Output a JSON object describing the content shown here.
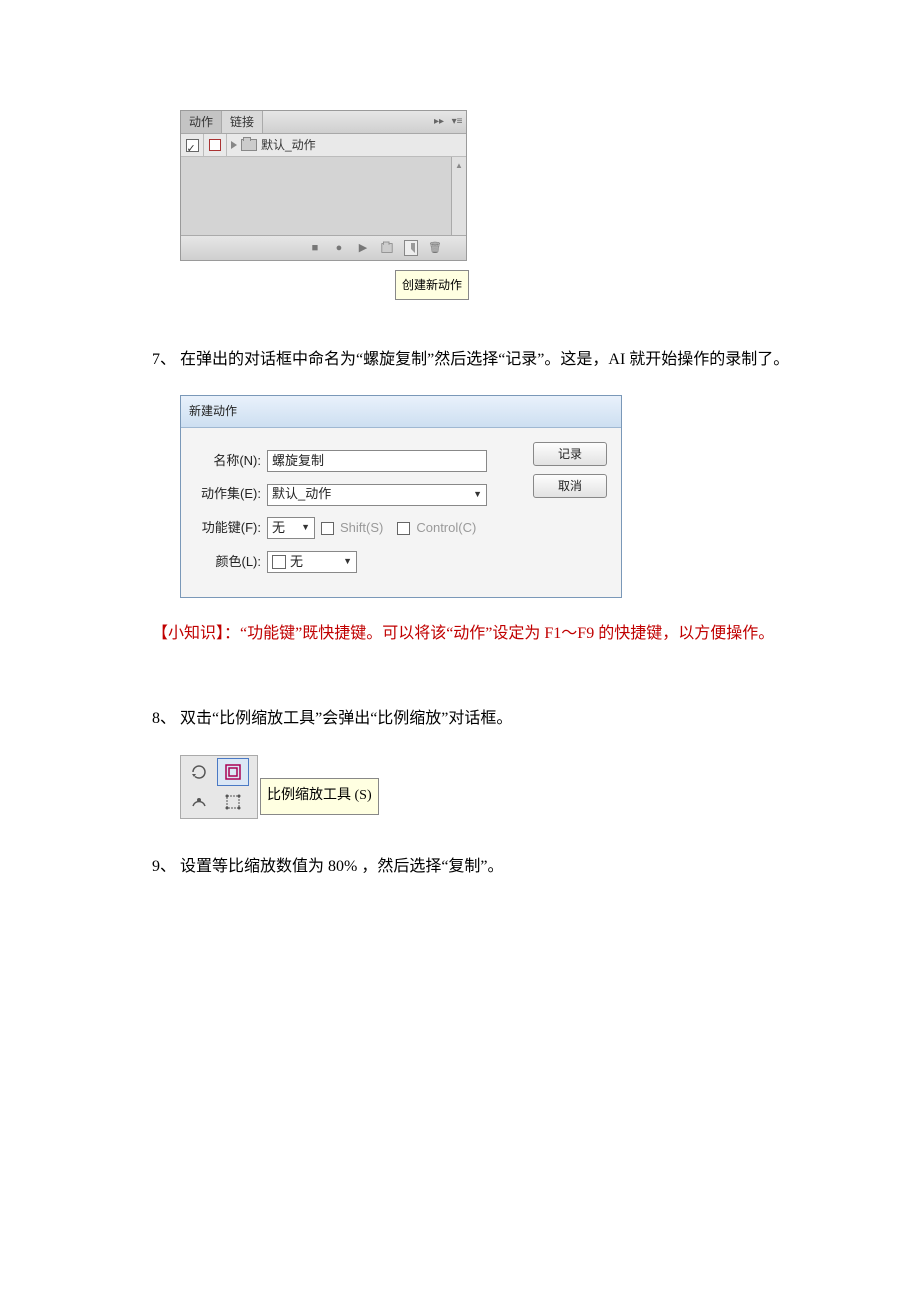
{
  "actions_panel": {
    "tab_actions": "动作",
    "tab_links": "链接",
    "row_label": "默认_动作",
    "tooltip": "创建新动作"
  },
  "step7": "7、 在弹出的对话框中命名为“螺旋复制”然后选择“记录”。这是，AI 就开始操作的录制了。",
  "new_action_dialog": {
    "title": "新建动作",
    "name_label": "名称(N):",
    "name_value": "螺旋复制",
    "set_label": "动作集(E):",
    "set_value": "默认_动作",
    "fkey_label": "功能键(F):",
    "fkey_value": "无",
    "shift_label": "Shift(S)",
    "ctrl_label": "Control(C)",
    "color_label": "颜色(L):",
    "color_value": "无",
    "btn_record": "记录",
    "btn_cancel": "取消"
  },
  "tip_text": "【小知识】：“功能键”既快捷键。可以将该“动作”设定为 F1～F9 的快捷键，以方便操作。",
  "step8": "8、 双击“比例缩放工具”会弹出“比例缩放”对话框。",
  "scale_tool_tip": "比例缩放工具 (S)",
  "step9": "9、 设置等比缩放数值为 80% ，然后选择“复制”。"
}
